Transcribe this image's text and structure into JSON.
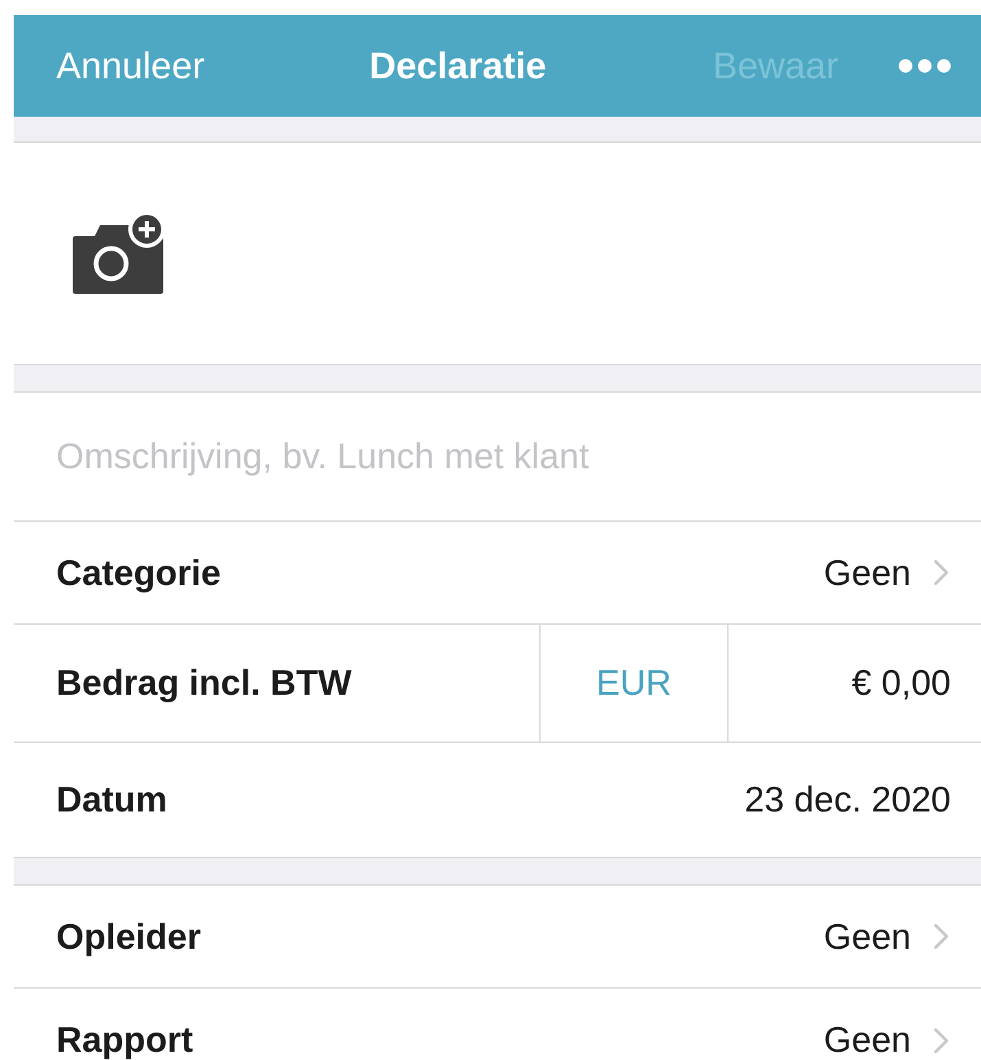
{
  "nav_bar": {
    "cancel": "Annuleer",
    "title": "Declaratie",
    "save": {
      "label": "Bewaar",
      "disabled": true
    }
  },
  "description": {
    "placeholder": "Omschrijving, bv. Lunch met klant"
  },
  "rows": [
    {
      "kind": "picker",
      "label": "Categorie",
      "value": "Geen"
    },
    {
      "kind": "amount",
      "label": "Bedrag incl. BTW",
      "currency": "EUR",
      "value": "€ 0,00"
    },
    {
      "kind": "plain",
      "label": "Datum",
      "value": "23 dec. 2020"
    },
    {
      "kind": "gap"
    },
    {
      "kind": "picker",
      "label": "Opleider",
      "value": "Geen"
    },
    {
      "kind": "picker",
      "label": "Rapport",
      "value": "Geen"
    }
  ]
}
